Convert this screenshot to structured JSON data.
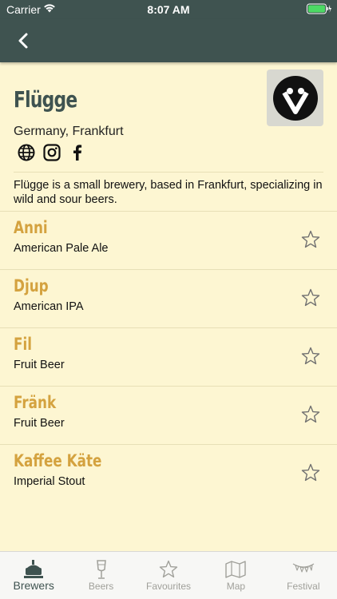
{
  "status": {
    "carrier": "Carrier",
    "time": "8:07 AM"
  },
  "nav": {
    "back_icon": "chevron-left-icon"
  },
  "brewery": {
    "name": "Flügge",
    "location": "Germany, Frankfurt",
    "description": "Flügge is a small brewery, based in Frankfurt, specializing in wild and sour beers.",
    "social": [
      "globe-icon",
      "instagram-icon",
      "facebook-icon"
    ]
  },
  "beers": [
    {
      "name": "Anni",
      "style": "American Pale Ale"
    },
    {
      "name": "Djup",
      "style": "American IPA"
    },
    {
      "name": "Fil",
      "style": "Fruit Beer"
    },
    {
      "name": "Fränk",
      "style": "Fruit Beer"
    },
    {
      "name": "Kaffee Käte",
      "style": "Imperial Stout"
    }
  ],
  "tabs": [
    {
      "label": "Brewers",
      "icon": "brewery-kettle-icon",
      "active": true
    },
    {
      "label": "Beers",
      "icon": "beer-glass-icon",
      "active": false
    },
    {
      "label": "Favourites",
      "icon": "star-icon",
      "active": false
    },
    {
      "label": "Map",
      "icon": "map-icon",
      "active": false
    },
    {
      "label": "Festival",
      "icon": "bunting-icon",
      "active": false
    }
  ],
  "colors": {
    "header": "#3f5350",
    "background": "#fdf6d2",
    "beer_name": "#d4a23f",
    "battery": "#4cd964"
  }
}
